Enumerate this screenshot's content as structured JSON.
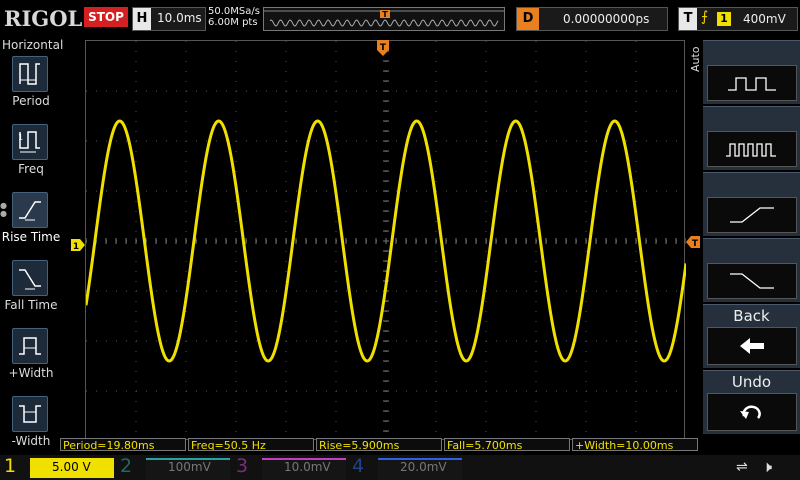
{
  "brand": "RIGOL",
  "run_state": "STOP",
  "horizontal": {
    "key": "H",
    "timebase": "10.0ms"
  },
  "sample": {
    "rate": "50.0MSa/s",
    "points": "6.00M pts"
  },
  "delay": {
    "key": "D",
    "value": "0.00000000ps"
  },
  "trigger": {
    "key": "T",
    "slope_icon": "rising-edge",
    "channel": "1",
    "level": "400mV"
  },
  "left_menu": {
    "title": "Horizontal",
    "items": [
      {
        "label": "Period",
        "icon": "period-icon"
      },
      {
        "label": "Freq",
        "icon": "freq-icon"
      },
      {
        "label": "Rise Time",
        "icon": "rise-time-icon"
      },
      {
        "label": "Fall Time",
        "icon": "fall-time-icon"
      },
      {
        "label": "+Width",
        "icon": "pos-width-icon"
      },
      {
        "label": "-Width",
        "icon": "neg-width-icon"
      }
    ]
  },
  "right_menu": {
    "mode": "Auto",
    "buttons": [
      {
        "label": "",
        "icon": "square-wave-icon"
      },
      {
        "label": "",
        "icon": "pulse-train-icon"
      },
      {
        "label": "",
        "icon": "rising-edge-icon"
      },
      {
        "label": "",
        "icon": "falling-edge-icon"
      },
      {
        "label": "Back",
        "icon": "left-arrow-icon"
      },
      {
        "label": "Undo",
        "icon": "undo-icon"
      }
    ]
  },
  "markers": {
    "channel_marker": "1",
    "trigger_pos": "T",
    "trigger_level": "T"
  },
  "measurements": [
    "Period=19.80ms",
    "Freq=50.5 Hz",
    "Rise=5.900ms",
    "Fall=5.700ms",
    "+Width=10.00ms"
  ],
  "channels": [
    {
      "num": "1",
      "scale": "5.00 V",
      "color": "#f0e000",
      "active": true
    },
    {
      "num": "2",
      "scale": "100mV",
      "color": "#2aa0a0",
      "active": false
    },
    {
      "num": "3",
      "scale": "10.0mV",
      "color": "#c040c0",
      "active": false
    },
    {
      "num": "4",
      "scale": "20.0mV",
      "color": "#3060e0",
      "active": false
    }
  ],
  "waveform": {
    "color": "#f0e000",
    "cycles_visible": 6.06,
    "amplitude_div": 2.4
  }
}
